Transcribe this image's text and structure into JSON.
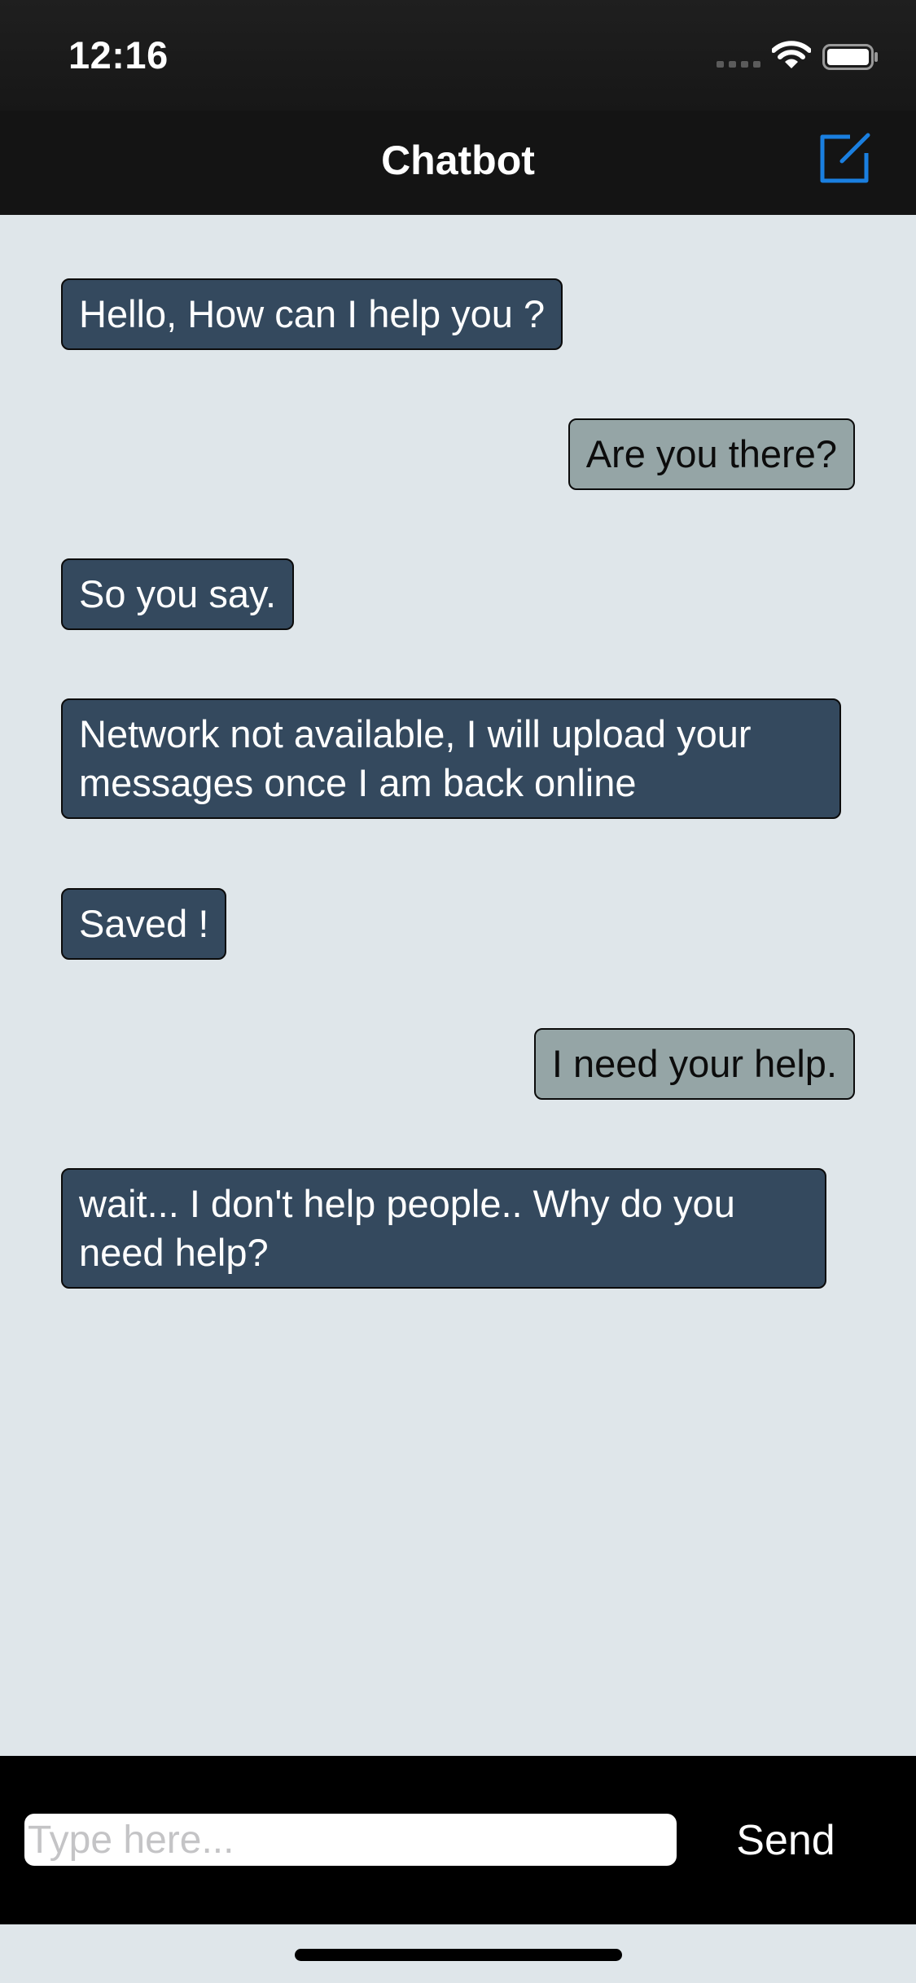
{
  "status_bar": {
    "time": "12:16",
    "icons": [
      "cellular-signal-icon",
      "wifi-icon",
      "battery-icon"
    ]
  },
  "nav": {
    "title": "Chatbot",
    "compose_icon": "compose-icon"
  },
  "messages": [
    {
      "sender": "bot",
      "text": "Hello, How can I help you ?"
    },
    {
      "sender": "user",
      "text": "Are you there?"
    },
    {
      "sender": "bot",
      "text": "So you say."
    },
    {
      "sender": "bot",
      "text": "Network not available, I will upload your messages once I am back online"
    },
    {
      "sender": "bot",
      "text": "Saved !"
    },
    {
      "sender": "user",
      "text": "I need your help."
    },
    {
      "sender": "bot",
      "text": "wait... I don't help people.. Why do you need help?"
    }
  ],
  "composer": {
    "input_value": "",
    "input_placeholder": "Type here...",
    "send_label": "Send"
  },
  "colors": {
    "bot_bubble": "#34495e",
    "user_bubble": "#95a5a6",
    "chat_background": "#dfe6ea",
    "accent": "#1a7fe0"
  }
}
